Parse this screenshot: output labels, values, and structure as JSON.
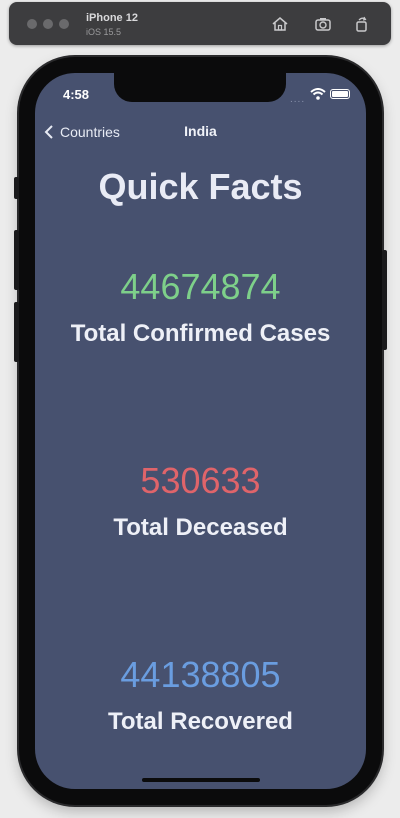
{
  "simulator": {
    "device_name": "iPhone 12",
    "os_version": "iOS 15.5",
    "icons": [
      "home-icon",
      "screenshot-icon",
      "rotate-icon"
    ]
  },
  "status_bar": {
    "time": "4:58",
    "signal": "....",
    "icons": [
      "wifi-icon",
      "battery-icon"
    ]
  },
  "nav": {
    "back_label": "Countries",
    "title": "India"
  },
  "page": {
    "heading": "Quick Facts"
  },
  "stats": [
    {
      "value": "44674874",
      "label": "Total Confirmed Cases",
      "color": "#7ed08a"
    },
    {
      "value": "530633",
      "label": "Total Deceased",
      "color": "#e0646a"
    },
    {
      "value": "44138805",
      "label": "Total Recovered",
      "color": "#6a9de0"
    }
  ],
  "colors": {
    "screen_bg": "#47516f",
    "text": "#eef0f7"
  }
}
